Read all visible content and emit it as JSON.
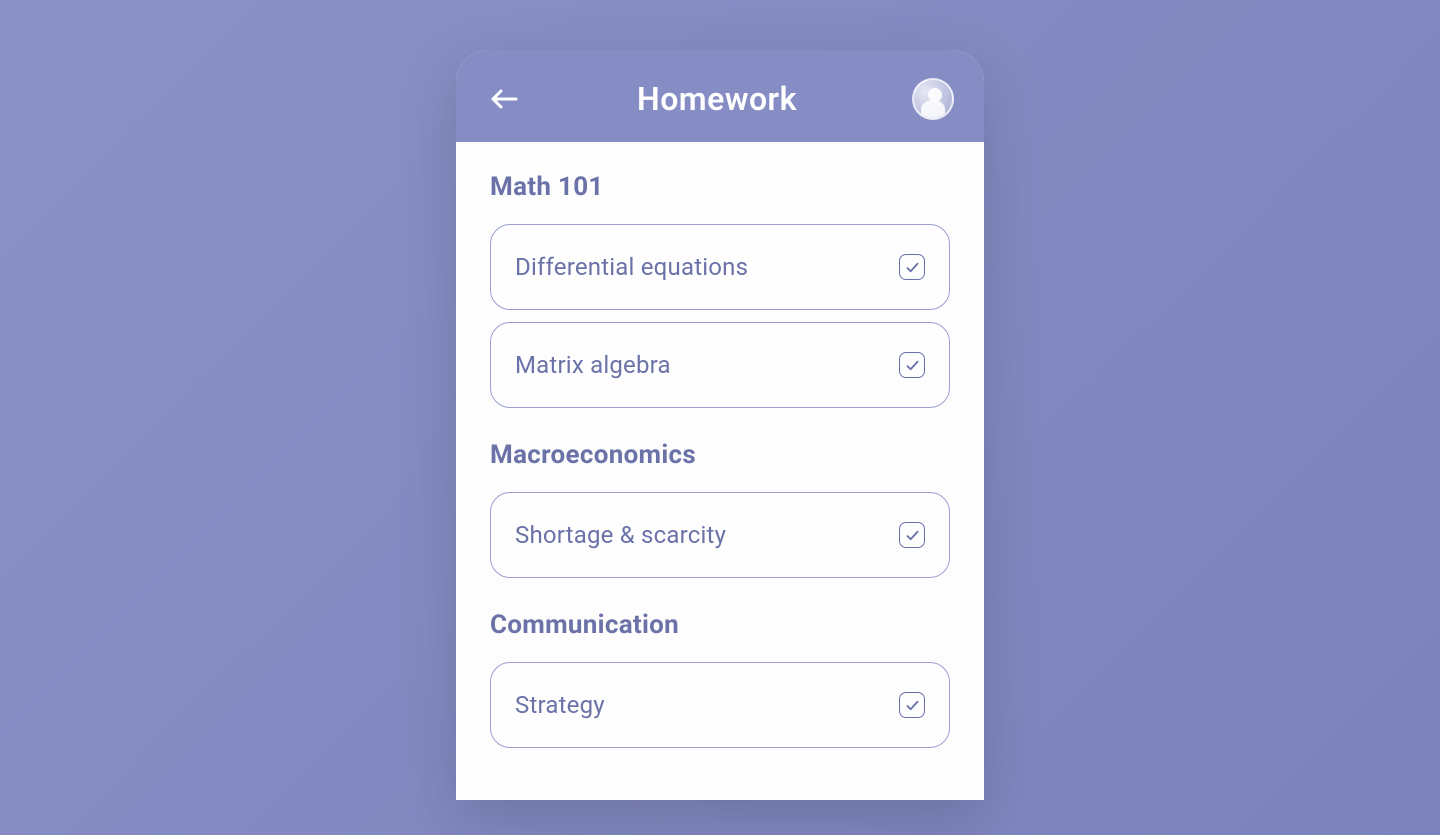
{
  "header": {
    "title": "Homework"
  },
  "sections": [
    {
      "title": "Math 101",
      "tasks": [
        {
          "label": "Differential equations",
          "checked": true
        },
        {
          "label": "Matrix algebra",
          "checked": true
        }
      ]
    },
    {
      "title": "Macroeconomics",
      "tasks": [
        {
          "label": "Shortage & scarcity",
          "checked": true
        }
      ]
    },
    {
      "title": "Communication",
      "tasks": [
        {
          "label": "Strategy",
          "checked": true
        }
      ]
    }
  ]
}
